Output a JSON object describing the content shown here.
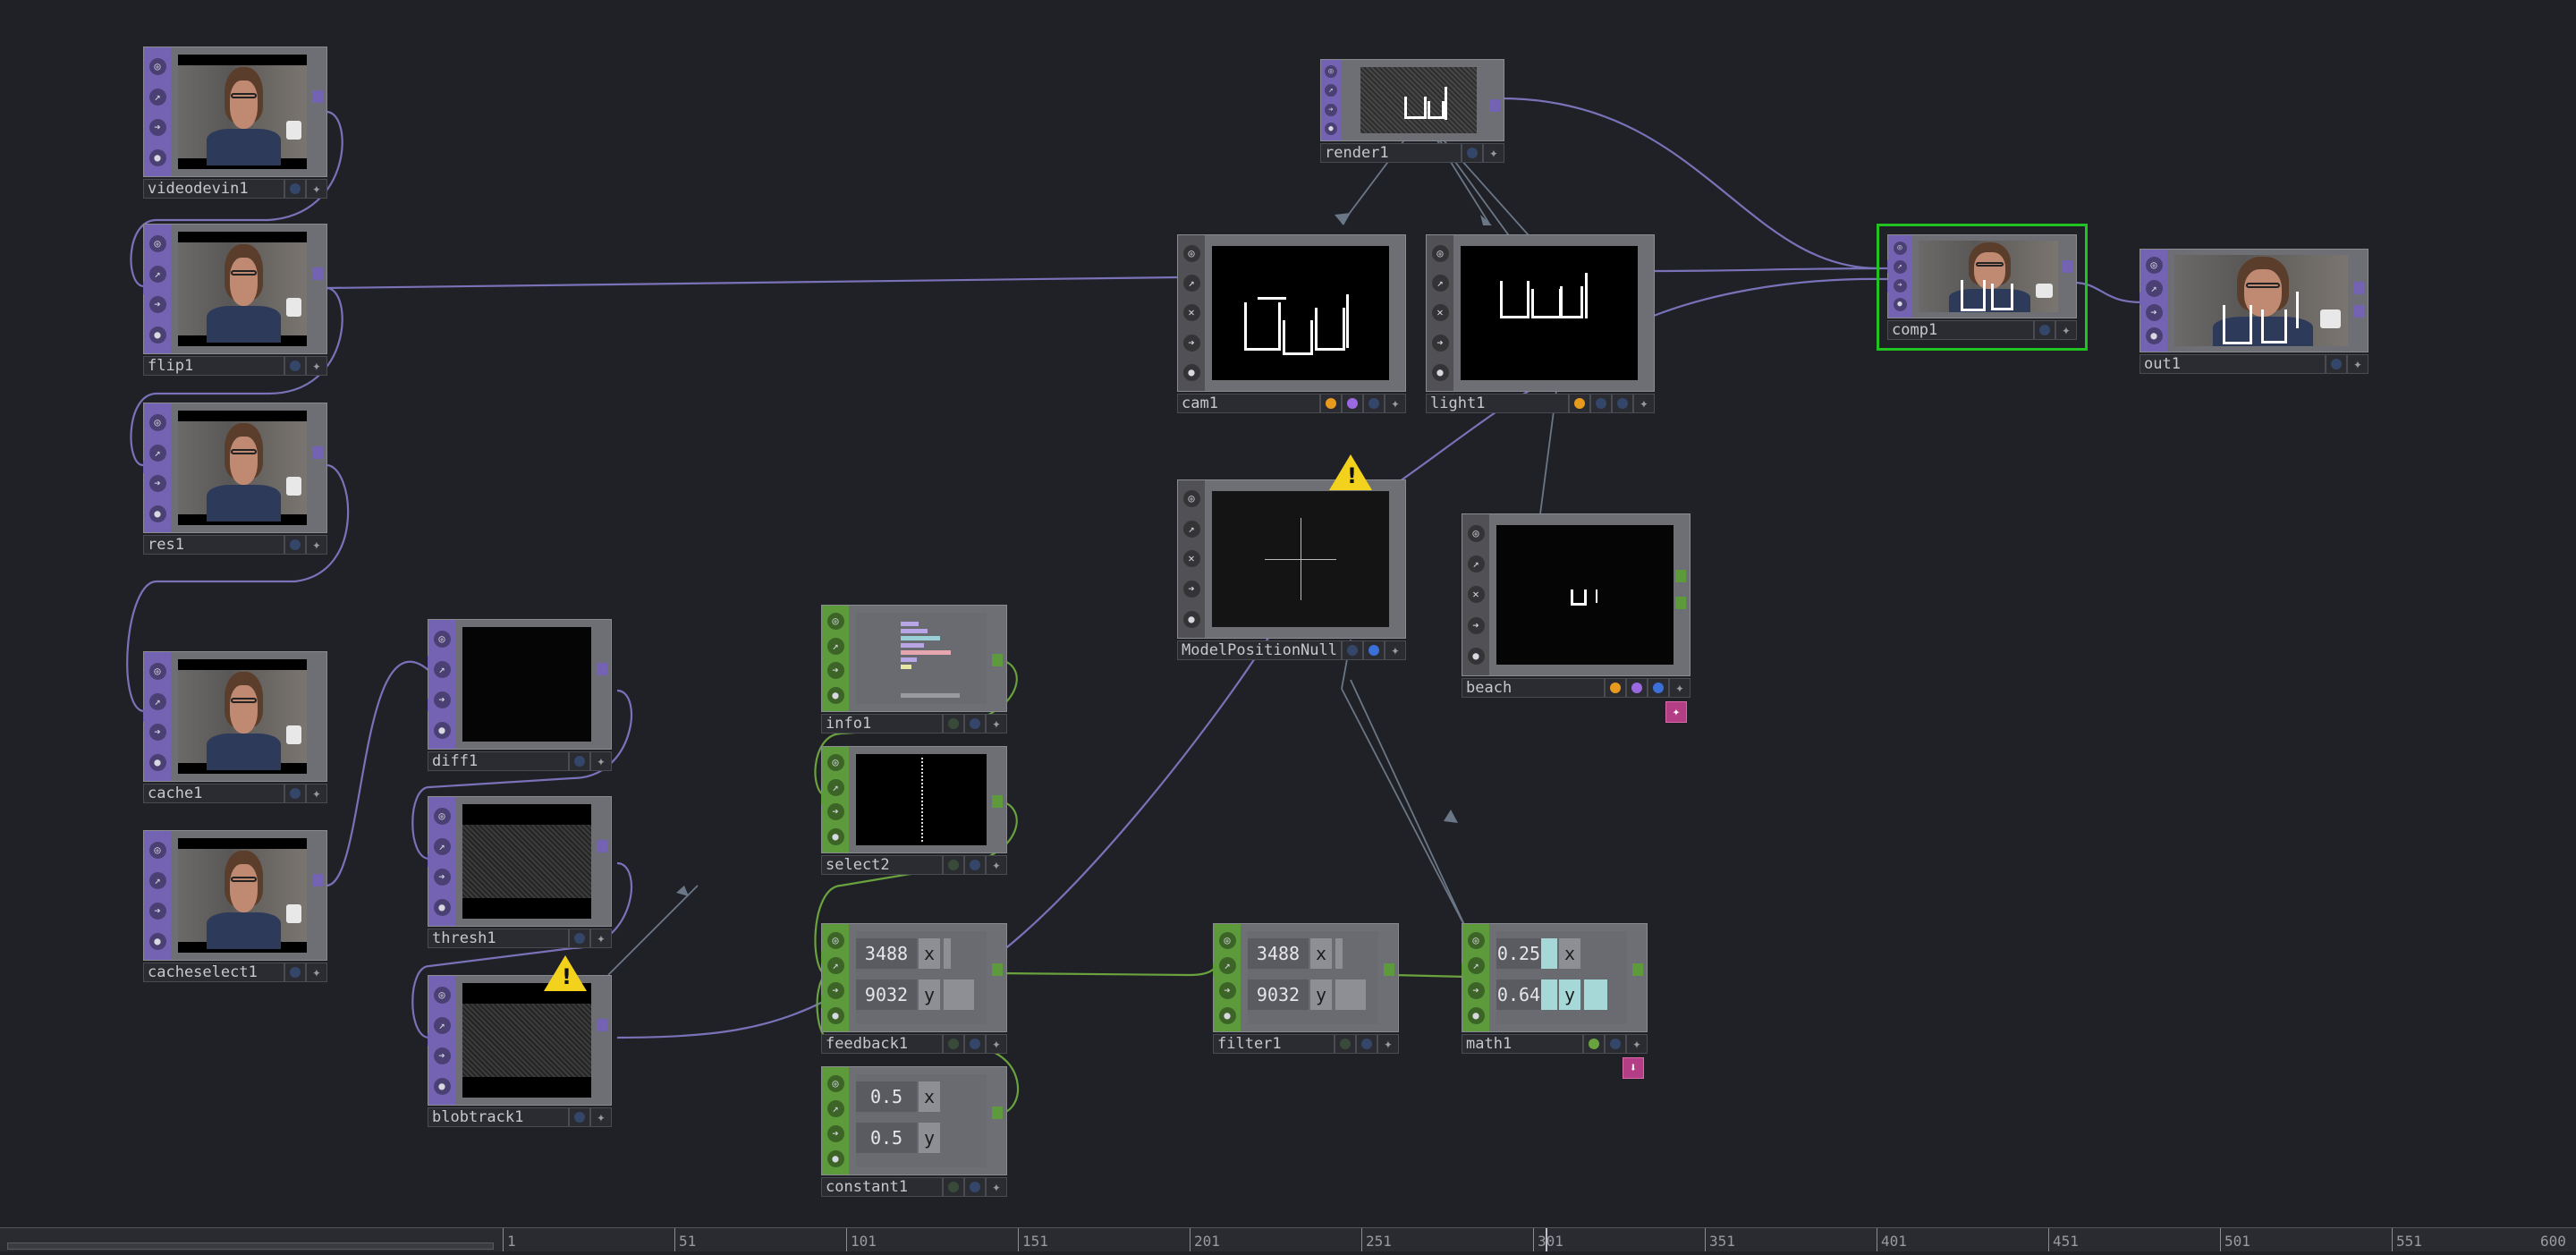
{
  "nodes": {
    "videodevin1": {
      "name": "videodevin1"
    },
    "flip1": {
      "name": "flip1"
    },
    "res1": {
      "name": "res1"
    },
    "cache1": {
      "name": "cache1"
    },
    "cacheselect1": {
      "name": "cacheselect1"
    },
    "diff1": {
      "name": "diff1"
    },
    "thresh1": {
      "name": "thresh1"
    },
    "blobtrack1": {
      "name": "blobtrack1"
    },
    "info1": {
      "name": "info1"
    },
    "select2": {
      "name": "select2"
    },
    "feedback1": {
      "name": "feedback1",
      "values": [
        "3488",
        "9032"
      ],
      "channels": [
        "x",
        "y"
      ]
    },
    "constant1": {
      "name": "constant1",
      "values": [
        "0.5",
        "0.5"
      ],
      "channels": [
        "x",
        "y"
      ]
    },
    "filter1": {
      "name": "filter1",
      "values": [
        "3488",
        "9032"
      ],
      "channels": [
        "x",
        "y"
      ]
    },
    "math1": {
      "name": "math1",
      "values": [
        "0.25",
        "0.64"
      ],
      "channels": [
        "x",
        "y"
      ]
    },
    "render1": {
      "name": "render1"
    },
    "cam1": {
      "name": "cam1"
    },
    "light1": {
      "name": "light1"
    },
    "modelpositionnull": {
      "name": "ModelPositionNull"
    },
    "beach": {
      "name": "beach"
    },
    "comp1": {
      "name": "comp1"
    },
    "out1": {
      "name": "out1"
    }
  },
  "timeline": {
    "ticks": [
      "1",
      "51",
      "101",
      "151",
      "201",
      "251",
      "301",
      "351",
      "401",
      "451",
      "501",
      "551",
      "600"
    ],
    "current_frame": 301
  },
  "colors": {
    "background": "#1f2127",
    "top_family": "#7463b2",
    "chop_family": "#5c9a3c",
    "wire_top": "#7a72b8",
    "wire_chop": "#6aa33e",
    "selected_outline": "#21c321",
    "warning": "#f3d21d"
  },
  "icons": [
    "warning-icon",
    "viewer-icon",
    "bypass-icon",
    "clone-icon",
    "lock-icon",
    "cooking-icon",
    "add-icon",
    "flag-icon"
  ]
}
